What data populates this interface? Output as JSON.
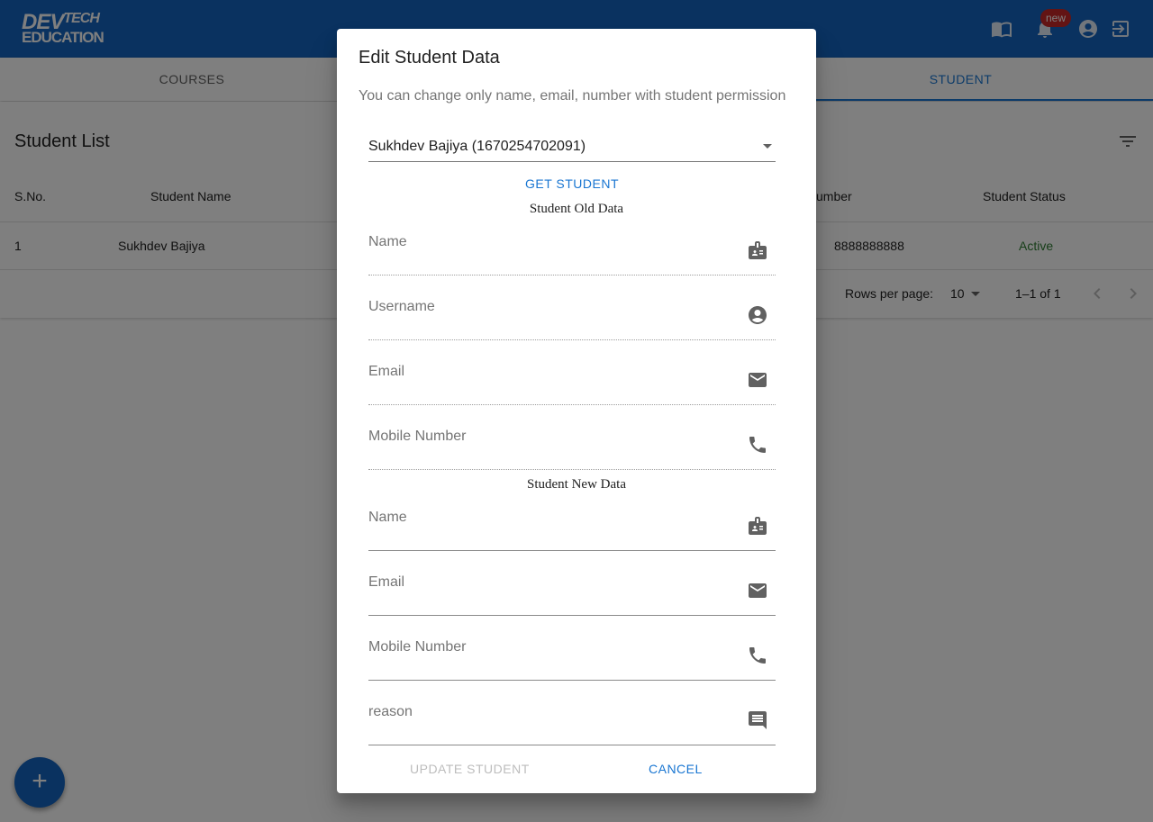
{
  "app": {
    "logo_top": "DEV",
    "logo_top_small": "TECH",
    "logo_bottom": "EDUCATION",
    "badge": "new"
  },
  "tabs": [
    {
      "label": "COURSES",
      "active": false
    },
    {
      "label": "STUDENT",
      "active": true
    }
  ],
  "table": {
    "title": "Student List",
    "headers": [
      "S.No.",
      "Student Name",
      "umber",
      "Student Status"
    ],
    "rows": [
      {
        "sno": "1",
        "name": "Sukhdev Bajiya",
        "number": "8888888888",
        "status": "Active"
      }
    ],
    "rows_per_page_label": "Rows per page:",
    "rows_per_page": "10",
    "range": "1–1 of 1"
  },
  "dialog": {
    "title": "Edit Student Data",
    "description": "You can change only name, email, number with student permission",
    "selected_student": "Sukhdev Bajiya (1670254702091)",
    "get_student_label": "GET STUDENT",
    "old_section_label": "Student Old Data",
    "old_fields": [
      {
        "label": "Name",
        "icon": "contact-card-icon"
      },
      {
        "label": "Username",
        "icon": "account-circle-icon"
      },
      {
        "label": "Email",
        "icon": "email-icon"
      },
      {
        "label": "Mobile Number",
        "icon": "phone-icon"
      }
    ],
    "new_section_label": "Student New Data",
    "new_fields": [
      {
        "label": "Name",
        "icon": "contact-card-icon"
      },
      {
        "label": "Email",
        "icon": "email-icon"
      },
      {
        "label": "Mobile Number",
        "icon": "phone-icon"
      },
      {
        "label": "reason",
        "icon": "comment-icon"
      }
    ],
    "update_label": "UPDATE STUDENT",
    "cancel_label": "CANCEL"
  },
  "fab": {
    "label": "+"
  },
  "colors": {
    "primary": "#1565c0",
    "accent": "#1976d2",
    "status_active": "#2e7d32",
    "badge": "#c62828"
  }
}
